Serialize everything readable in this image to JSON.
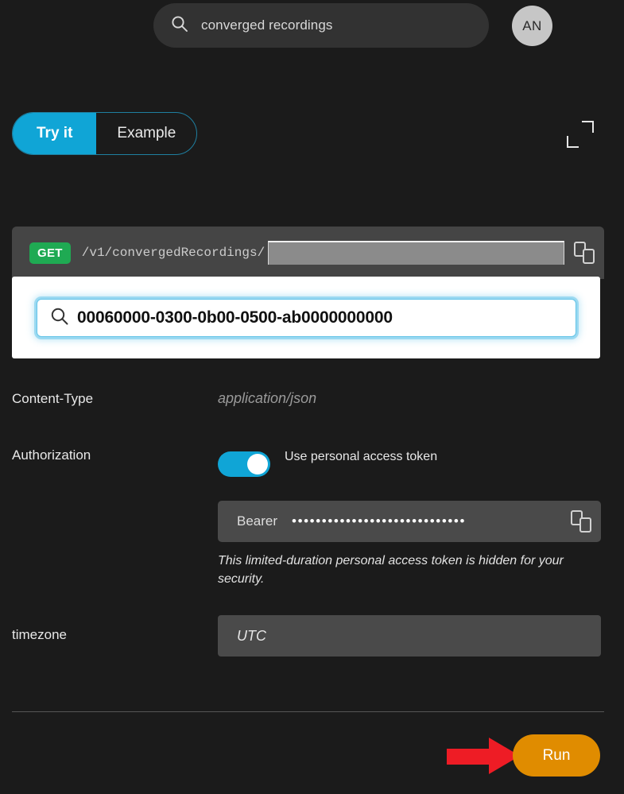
{
  "topbar": {
    "search_value": "converged recordings",
    "search_placeholder": "Search",
    "avatar_initials": "AN"
  },
  "tabs": {
    "try_it": "Try it",
    "example": "Example"
  },
  "request": {
    "method": "GET",
    "path": "/v1/convergedRecordings/",
    "path_param_value": "",
    "path_param_placeholder": ""
  },
  "autocomplete": {
    "value": "00060000-0300-0b00-0500-ab0000000000",
    "placeholder": ""
  },
  "params": {
    "content_type_label": "Content-Type",
    "content_type_value": "application/json",
    "authorization_label": "Authorization",
    "toggle_label": "Use personal access token",
    "bearer_prefix": "Bearer",
    "bearer_masked": "•••••••••••••••••••••••••••••",
    "token_helper": "This limited-duration personal access token is hidden for your security.",
    "timezone_label": "timezone",
    "timezone_placeholder": "UTC",
    "timezone_value": ""
  },
  "footer": {
    "run_label": "Run"
  },
  "colors": {
    "accent_cyan": "#10a5d6",
    "method_green": "#1faa53",
    "run_orange": "#e08c00",
    "arrow_red": "#ee1c25",
    "background": "#1b1b1b"
  }
}
